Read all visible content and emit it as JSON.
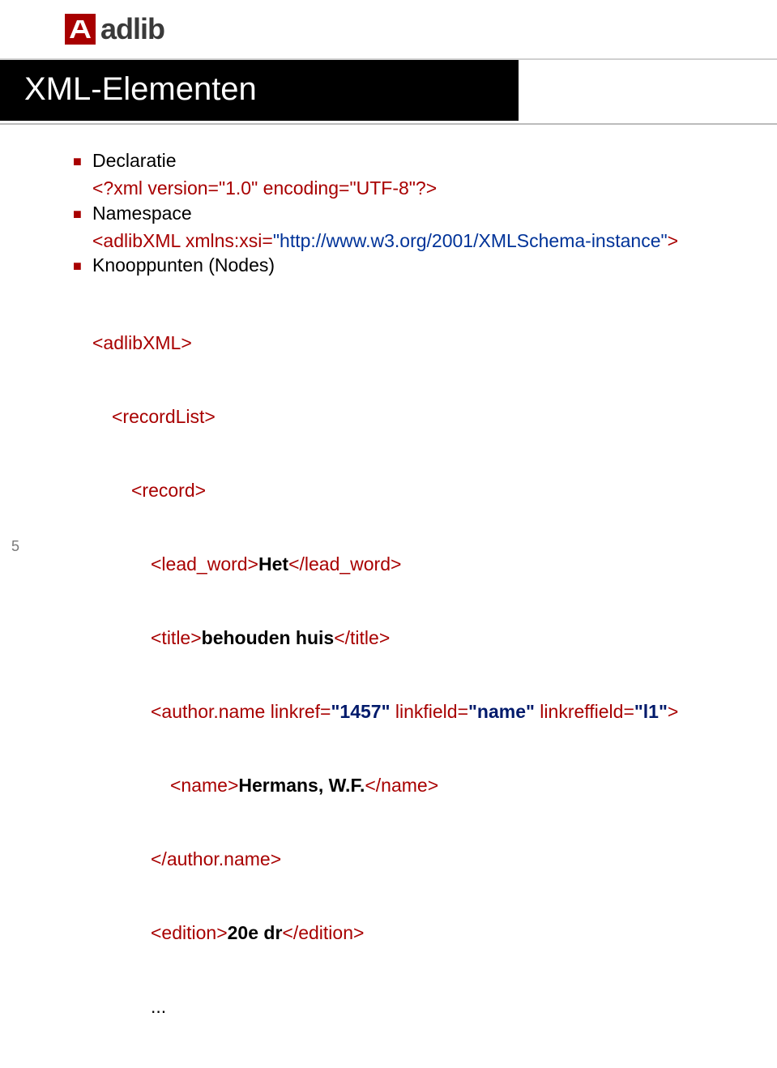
{
  "logo": {
    "text": "adlib"
  },
  "title": "XML-Elementen",
  "bullets": {
    "b1_label": "Declaratie",
    "b1_code_decl": "<?xml version=\"1.0\" encoding=\"UTF-8\"?>",
    "b2_label": "Namespace",
    "b2_open": "<adlibXML xmlns:xsi=",
    "b2_url": "\"http://www.w3.org/2001/XMLSchema-instance\"",
    "b2_close": ">",
    "b3_label": "Knooppunten (Nodes)",
    "b3_adlib": "<adlibXML>",
    "b3_reclist": "<recordList>",
    "b3_record": "<record>",
    "b3_lead_open": "<lead_word>",
    "b3_lead_val": "Het",
    "b3_lead_close": "</lead_word>",
    "b3_title_open": "<title>",
    "b3_title_val": "behouden huis",
    "b3_title_close": "</title>",
    "b3_auth_open_tag": "<author.name",
    "b3_auth_attrs_keys": " linkref=",
    "b3_auth_linkref_val": "\"1457\"",
    "b3_auth_linkfield_key": " linkfield=",
    "b3_auth_linkfield_val": "\"name\"",
    "b3_auth_linkreffield_key": " linkreffield=",
    "b3_auth_linkreffield_val": "\"l1\"",
    "b3_auth_open_end": ">",
    "b3_name_open": "<name>",
    "b3_name_val": "Hermans, W.F.",
    "b3_name_close": "</name>",
    "b3_auth_close": "</author.name>",
    "b3_edition_open": "<edition>",
    "b3_edition_val": "20e dr",
    "b3_edition_close": "</edition>",
    "b3_dots": "..."
  },
  "slide_number": "5"
}
